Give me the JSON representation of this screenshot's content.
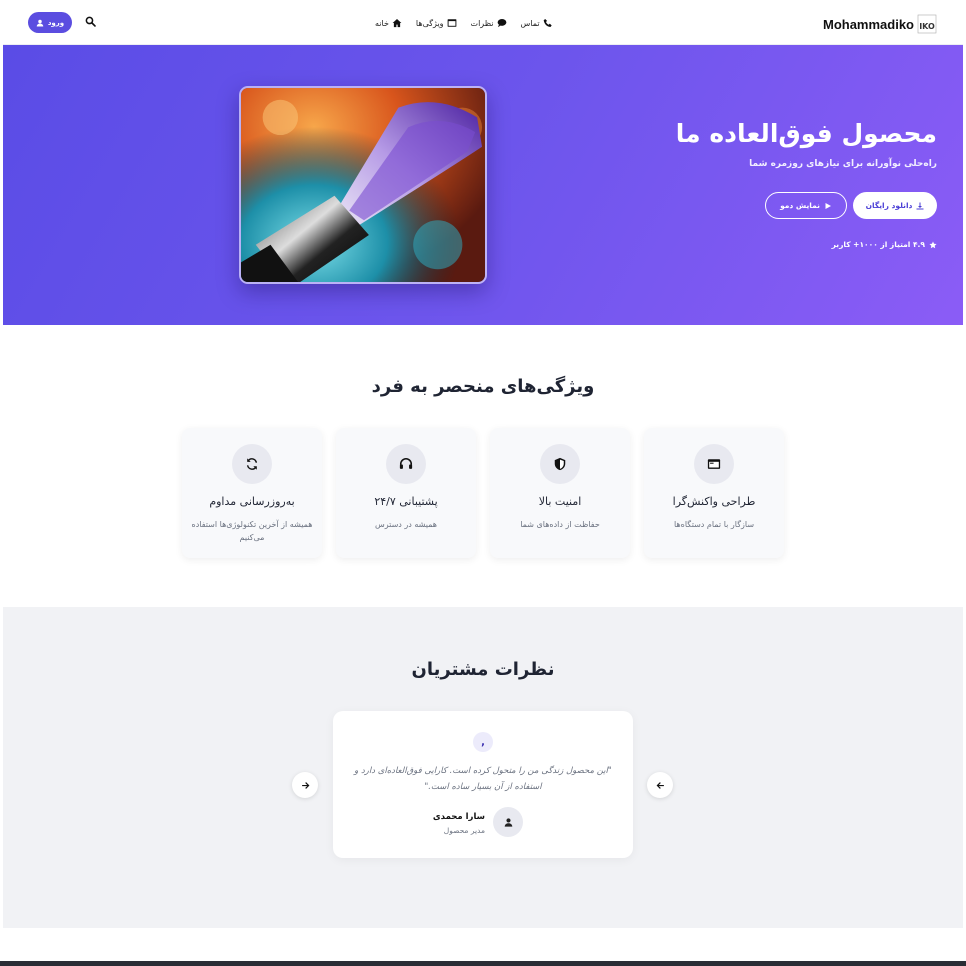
{
  "header": {
    "brand": "Mohammadiko",
    "logo_text": "IKO",
    "login_label": "ورود",
    "nav": [
      {
        "label": "خانه",
        "icon": "home-icon"
      },
      {
        "label": "ویژگی‌ها",
        "icon": "window-icon"
      },
      {
        "label": "نظرات",
        "icon": "chat-icon"
      },
      {
        "label": "تماس",
        "icon": "phone-icon"
      }
    ]
  },
  "hero": {
    "title": "محصول فوق‌العاده ما",
    "subtitle": "راه‌حلی نوآورانه برای نیازهای روزمره شما",
    "primary_button": "دانلود رایگان",
    "secondary_button": "نمایش دمو",
    "rating": "۴.۹ امتیاز از ۱۰۰۰+ کاربر",
    "accent": "#5b4de0"
  },
  "features": {
    "title": "ویژگی‌های منحصر به فرد",
    "items": [
      {
        "title": "طراحی واکنش‌گرا",
        "desc": "سازگار با تمام دستگاه‌ها",
        "icon": "window-icon"
      },
      {
        "title": "امنیت بالا",
        "desc": "حفاظت از داده‌های شما",
        "icon": "shield-icon"
      },
      {
        "title": "پشتیبانی ۲۴/۷",
        "desc": "همیشه در دسترس",
        "icon": "headset-icon"
      },
      {
        "title": "به‌روزرسانی مداوم",
        "desc": "همیشه از آخرین تکنولوژی‌ها استفاده می‌کنیم",
        "icon": "sync-icon"
      }
    ]
  },
  "testimonials": {
    "title": "نظرات مشتریان",
    "quote_mark": ",",
    "text": "\"این محصول زندگی من را متحول کرده است. کارایی فوق‌العاده‌ای دارد و استفاده از آن بسیار ساده است.\"",
    "name": "سارا محمدی",
    "role": "مدیر محصول"
  }
}
